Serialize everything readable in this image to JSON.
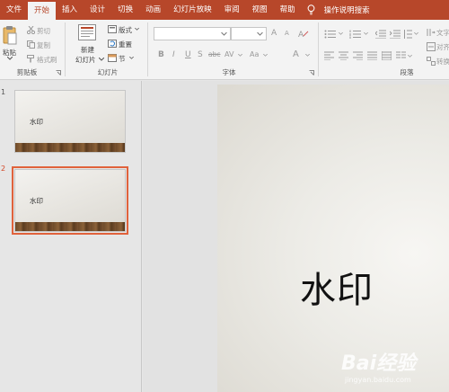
{
  "tabs": [
    "文件",
    "开始",
    "插入",
    "设计",
    "切换",
    "动画",
    "幻灯片放映",
    "审阅",
    "视图",
    "帮助"
  ],
  "active_tab": "开始",
  "tell_me": "操作说明搜索",
  "ribbon": {
    "clipboard": {
      "paste": "粘贴",
      "cut": "剪切",
      "copy": "复制",
      "format_painter": "格式刷",
      "label": "剪贴板"
    },
    "slides": {
      "new_slide_1": "新建",
      "new_slide_2": "幻灯片",
      "layout": "版式",
      "reset": "重置",
      "section": "节",
      "label": "幻灯片"
    },
    "font": {
      "label": "字体",
      "bold": "B",
      "italic": "I",
      "underline": "U",
      "strike": "S",
      "shadow": "abc",
      "spacing": "AV",
      "aa": "Aa",
      "color_a": "A",
      "grow": "A",
      "shrink": "A"
    },
    "paragraph": {
      "label": "段落",
      "text_dir": "文字",
      "align_text": "对齐",
      "convert": "转换"
    }
  },
  "slides": [
    {
      "number": "1",
      "text": "水印"
    },
    {
      "number": "2",
      "text": "水印"
    }
  ],
  "current_slide_text": "水印",
  "watermark": {
    "logo": "Bai经验",
    "url": "jingyan.baidu.com"
  },
  "colors": {
    "accent": "#b7472a",
    "selection": "#e0623c"
  }
}
